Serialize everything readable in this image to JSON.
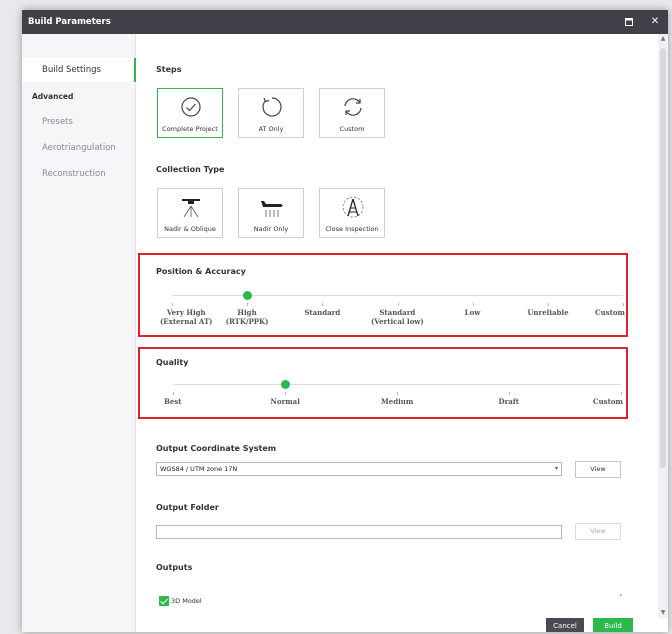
{
  "window": {
    "title": "Build Parameters"
  },
  "sidebar": {
    "items": [
      {
        "label": "Build Settings"
      },
      {
        "label": "Presets"
      },
      {
        "label": "Aerotriangulation"
      },
      {
        "label": "Reconstruction"
      }
    ],
    "advanced_header": "Advanced"
  },
  "steps": {
    "title": "Steps",
    "options": [
      {
        "label": "Complete Project",
        "icon": "check-circle-icon"
      },
      {
        "label": "AT Only",
        "icon": "refresh-arrow-icon"
      },
      {
        "label": "Custom",
        "icon": "cycle-arrows-icon"
      }
    ],
    "selected": "Complete Project"
  },
  "collection": {
    "title": "Collection Type",
    "options": [
      {
        "label": "Nadir & Oblique",
        "icon": "drone-icon"
      },
      {
        "label": "Nadir Only",
        "icon": "airplane-icon"
      },
      {
        "label": "Close Inspection",
        "icon": "tower-icon"
      }
    ]
  },
  "position": {
    "title": "Position & Accuracy",
    "levels": [
      [
        "Very High",
        "(External AT)"
      ],
      [
        "High",
        "(RTK/PPK)"
      ],
      [
        "Standard",
        ""
      ],
      [
        "Standard",
        "(Vertical low)"
      ],
      [
        "Low",
        ""
      ],
      [
        "Unreliable",
        ""
      ],
      [
        "Custom",
        ""
      ]
    ],
    "selected_index": 1
  },
  "quality": {
    "title": "Quality",
    "levels": [
      "Best",
      "Normal",
      "Medium",
      "Draft",
      "Custom"
    ],
    "selected_index": 1
  },
  "ocs": {
    "title": "Output Coordinate System",
    "value": "WGS84 / UTM zone 17N",
    "view_label": "View"
  },
  "folder": {
    "title": "Output Folder",
    "value": "",
    "view_label": "View"
  },
  "outputs": {
    "title": "Outputs",
    "items": [
      {
        "label": "3D Model",
        "checked": true
      }
    ]
  },
  "footer": {
    "cancel_label": "Cancel",
    "build_label": "Build"
  },
  "colors": {
    "accent": "#2db84b",
    "highlight": "#d9252f",
    "titlebar": "#404048"
  }
}
